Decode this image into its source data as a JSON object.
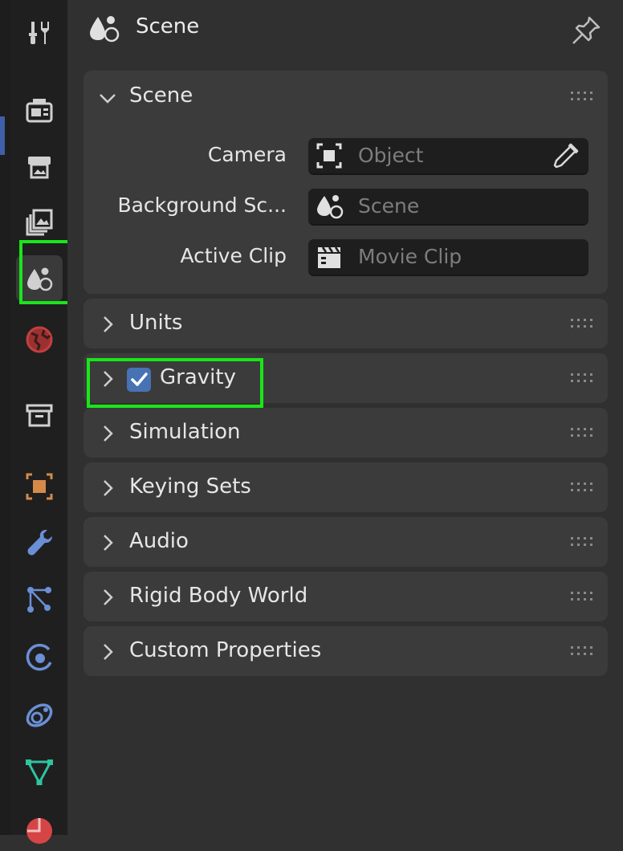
{
  "header": {
    "title": "Scene"
  },
  "tabs": [
    {
      "name": "tool",
      "icon": "tool-icon",
      "color": "#d0d0d0"
    },
    {
      "name": "render",
      "icon": "render-camera-icon",
      "color": "#d0d0d0"
    },
    {
      "name": "output",
      "icon": "printer-icon",
      "color": "#d0d0d0"
    },
    {
      "name": "view-layer",
      "icon": "image-stack-icon",
      "color": "#d0d0d0"
    },
    {
      "name": "scene",
      "icon": "scene-icon",
      "color": "#d0d0d0",
      "active": true
    },
    {
      "name": "world",
      "icon": "world-icon",
      "color": "#c04040"
    },
    {
      "name": "collection",
      "icon": "archive-box-icon",
      "color": "#d0d0d0"
    },
    {
      "name": "object",
      "icon": "object-icon",
      "color": "#d58a4a"
    },
    {
      "name": "modifiers",
      "icon": "wrench-icon",
      "color": "#6b8fd6"
    },
    {
      "name": "particles",
      "icon": "particles-icon",
      "color": "#6b8fd6"
    },
    {
      "name": "physics",
      "icon": "physics-icon",
      "color": "#6b8fd6"
    },
    {
      "name": "constraints",
      "icon": "constraint-icon",
      "color": "#6b8fd6"
    },
    {
      "name": "data",
      "icon": "mesh-data-icon",
      "color": "#2ec4a0"
    },
    {
      "name": "material",
      "icon": "material-icon",
      "color": "#d64545"
    }
  ],
  "scene_panel": {
    "title": "Scene",
    "props": [
      {
        "label": "Camera",
        "value": "Object",
        "icon": "camera-object-icon"
      },
      {
        "label": "Background Sc...",
        "value": "Scene",
        "icon": "scene-icon"
      },
      {
        "label": "Active Clip",
        "value": "Movie Clip",
        "icon": "movie-clip-icon"
      }
    ]
  },
  "panels": [
    {
      "title": "Units"
    },
    {
      "title": "Gravity",
      "checkbox": true,
      "checked": true
    },
    {
      "title": "Simulation"
    },
    {
      "title": "Keying Sets"
    },
    {
      "title": "Audio"
    },
    {
      "title": "Rigid Body World"
    },
    {
      "title": "Custom Properties"
    }
  ],
  "colors": {
    "accent": "#4772b3",
    "highlight": "#19e619",
    "panel_bg": "#3b3b3b",
    "field_bg": "#1e1e1e"
  }
}
